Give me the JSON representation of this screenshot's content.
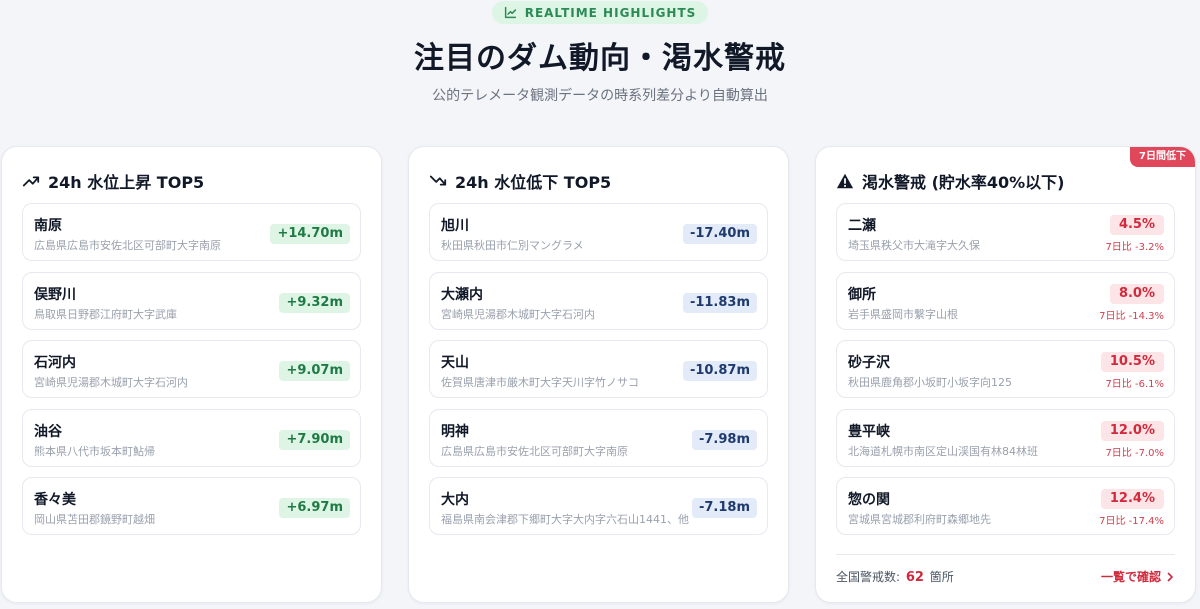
{
  "header": {
    "badge": "REALTIME HIGHLIGHTS",
    "title": "注目のダム動向・渇水警戒",
    "subtitle": "公的テレメータ観測データの時系列差分より自動算出"
  },
  "rise": {
    "title": "24h 水位上昇 TOP5",
    "items": [
      {
        "name": "南原",
        "address": "広島県広島市安佐北区可部町大字南原",
        "value": "+14.70m"
      },
      {
        "name": "俣野川",
        "address": "鳥取県日野郡江府町大字武庫",
        "value": "+9.32m"
      },
      {
        "name": "石河内",
        "address": "宮崎県児湯郡木城町大字石河内",
        "value": "+9.07m"
      },
      {
        "name": "油谷",
        "address": "熊本県八代市坂本町鮎帰",
        "value": "+7.90m"
      },
      {
        "name": "香々美",
        "address": "岡山県苫田郡鏡野町越畑",
        "value": "+6.97m"
      }
    ]
  },
  "fall": {
    "title": "24h 水位低下 TOP5",
    "items": [
      {
        "name": "旭川",
        "address": "秋田県秋田市仁別マングラメ",
        "value": "-17.40m"
      },
      {
        "name": "大瀬内",
        "address": "宮崎県児湯郡木城町大字石河内",
        "value": "-11.83m"
      },
      {
        "name": "天山",
        "address": "佐賀県唐津市厳木町大字天川字竹ノサコ",
        "value": "-10.87m"
      },
      {
        "name": "明神",
        "address": "広島県広島市安佐北区可部町大字南原",
        "value": "-7.98m"
      },
      {
        "name": "大内",
        "address": "福島県南会津郡下郷町大字大内字六石山1441、他",
        "value": "-7.18m"
      }
    ]
  },
  "drought": {
    "title": "渇水警戒 (貯水率40%以下)",
    "ribbon": "7日間低下",
    "items": [
      {
        "name": "二瀬",
        "address": "埼玉県秩父市大滝字大久保",
        "rate": "4.5%",
        "delta": "7日比 -3.2%"
      },
      {
        "name": "御所",
        "address": "岩手県盛岡市繋字山根",
        "rate": "8.0%",
        "delta": "7日比 -14.3%"
      },
      {
        "name": "砂子沢",
        "address": "秋田県鹿角郡小坂町小坂字向125",
        "rate": "10.5%",
        "delta": "7日比 -6.1%"
      },
      {
        "name": "豊平峡",
        "address": "北海道札幌市南区定山渓国有林84林班",
        "rate": "12.0%",
        "delta": "7日比 -7.0%"
      },
      {
        "name": "惣の関",
        "address": "宮城県宮城郡利府町森郷地先",
        "rate": "12.4%",
        "delta": "7日比 -17.4%"
      }
    ],
    "footer_prefix": "全国警戒数:",
    "footer_count": "62",
    "footer_suffix": "箇所",
    "link": "一覧で確認"
  }
}
